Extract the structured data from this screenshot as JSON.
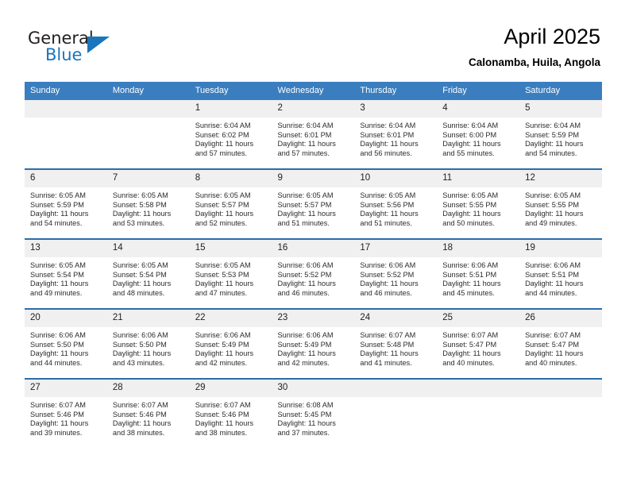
{
  "logo": {
    "word_one": "General",
    "word_two": "Blue",
    "triangle_color": "#1b75bb",
    "text_color": "#231f20"
  },
  "header": {
    "title": "April 2025",
    "location": "Calonamba, Huila, Angola"
  },
  "calendar": {
    "header_bg": "#3a7ebf",
    "row_divider_color": "#2c6ca8",
    "daynum_bg": "#f0f0f0",
    "weekdays": [
      "Sunday",
      "Monday",
      "Tuesday",
      "Wednesday",
      "Thursday",
      "Friday",
      "Saturday"
    ],
    "weeks": [
      [
        {
          "day": "",
          "lines": [
            "",
            "",
            "",
            ""
          ]
        },
        {
          "day": "",
          "lines": [
            "",
            "",
            "",
            ""
          ]
        },
        {
          "day": "1",
          "lines": [
            "Sunrise: 6:04 AM",
            "Sunset: 6:02 PM",
            "Daylight: 11 hours",
            "and 57 minutes."
          ]
        },
        {
          "day": "2",
          "lines": [
            "Sunrise: 6:04 AM",
            "Sunset: 6:01 PM",
            "Daylight: 11 hours",
            "and 57 minutes."
          ]
        },
        {
          "day": "3",
          "lines": [
            "Sunrise: 6:04 AM",
            "Sunset: 6:01 PM",
            "Daylight: 11 hours",
            "and 56 minutes."
          ]
        },
        {
          "day": "4",
          "lines": [
            "Sunrise: 6:04 AM",
            "Sunset: 6:00 PM",
            "Daylight: 11 hours",
            "and 55 minutes."
          ]
        },
        {
          "day": "5",
          "lines": [
            "Sunrise: 6:04 AM",
            "Sunset: 5:59 PM",
            "Daylight: 11 hours",
            "and 54 minutes."
          ]
        }
      ],
      [
        {
          "day": "6",
          "lines": [
            "Sunrise: 6:05 AM",
            "Sunset: 5:59 PM",
            "Daylight: 11 hours",
            "and 54 minutes."
          ]
        },
        {
          "day": "7",
          "lines": [
            "Sunrise: 6:05 AM",
            "Sunset: 5:58 PM",
            "Daylight: 11 hours",
            "and 53 minutes."
          ]
        },
        {
          "day": "8",
          "lines": [
            "Sunrise: 6:05 AM",
            "Sunset: 5:57 PM",
            "Daylight: 11 hours",
            "and 52 minutes."
          ]
        },
        {
          "day": "9",
          "lines": [
            "Sunrise: 6:05 AM",
            "Sunset: 5:57 PM",
            "Daylight: 11 hours",
            "and 51 minutes."
          ]
        },
        {
          "day": "10",
          "lines": [
            "Sunrise: 6:05 AM",
            "Sunset: 5:56 PM",
            "Daylight: 11 hours",
            "and 51 minutes."
          ]
        },
        {
          "day": "11",
          "lines": [
            "Sunrise: 6:05 AM",
            "Sunset: 5:55 PM",
            "Daylight: 11 hours",
            "and 50 minutes."
          ]
        },
        {
          "day": "12",
          "lines": [
            "Sunrise: 6:05 AM",
            "Sunset: 5:55 PM",
            "Daylight: 11 hours",
            "and 49 minutes."
          ]
        }
      ],
      [
        {
          "day": "13",
          "lines": [
            "Sunrise: 6:05 AM",
            "Sunset: 5:54 PM",
            "Daylight: 11 hours",
            "and 49 minutes."
          ]
        },
        {
          "day": "14",
          "lines": [
            "Sunrise: 6:05 AM",
            "Sunset: 5:54 PM",
            "Daylight: 11 hours",
            "and 48 minutes."
          ]
        },
        {
          "day": "15",
          "lines": [
            "Sunrise: 6:05 AM",
            "Sunset: 5:53 PM",
            "Daylight: 11 hours",
            "and 47 minutes."
          ]
        },
        {
          "day": "16",
          "lines": [
            "Sunrise: 6:06 AM",
            "Sunset: 5:52 PM",
            "Daylight: 11 hours",
            "and 46 minutes."
          ]
        },
        {
          "day": "17",
          "lines": [
            "Sunrise: 6:06 AM",
            "Sunset: 5:52 PM",
            "Daylight: 11 hours",
            "and 46 minutes."
          ]
        },
        {
          "day": "18",
          "lines": [
            "Sunrise: 6:06 AM",
            "Sunset: 5:51 PM",
            "Daylight: 11 hours",
            "and 45 minutes."
          ]
        },
        {
          "day": "19",
          "lines": [
            "Sunrise: 6:06 AM",
            "Sunset: 5:51 PM",
            "Daylight: 11 hours",
            "and 44 minutes."
          ]
        }
      ],
      [
        {
          "day": "20",
          "lines": [
            "Sunrise: 6:06 AM",
            "Sunset: 5:50 PM",
            "Daylight: 11 hours",
            "and 44 minutes."
          ]
        },
        {
          "day": "21",
          "lines": [
            "Sunrise: 6:06 AM",
            "Sunset: 5:50 PM",
            "Daylight: 11 hours",
            "and 43 minutes."
          ]
        },
        {
          "day": "22",
          "lines": [
            "Sunrise: 6:06 AM",
            "Sunset: 5:49 PM",
            "Daylight: 11 hours",
            "and 42 minutes."
          ]
        },
        {
          "day": "23",
          "lines": [
            "Sunrise: 6:06 AM",
            "Sunset: 5:49 PM",
            "Daylight: 11 hours",
            "and 42 minutes."
          ]
        },
        {
          "day": "24",
          "lines": [
            "Sunrise: 6:07 AM",
            "Sunset: 5:48 PM",
            "Daylight: 11 hours",
            "and 41 minutes."
          ]
        },
        {
          "day": "25",
          "lines": [
            "Sunrise: 6:07 AM",
            "Sunset: 5:47 PM",
            "Daylight: 11 hours",
            "and 40 minutes."
          ]
        },
        {
          "day": "26",
          "lines": [
            "Sunrise: 6:07 AM",
            "Sunset: 5:47 PM",
            "Daylight: 11 hours",
            "and 40 minutes."
          ]
        }
      ],
      [
        {
          "day": "27",
          "lines": [
            "Sunrise: 6:07 AM",
            "Sunset: 5:46 PM",
            "Daylight: 11 hours",
            "and 39 minutes."
          ]
        },
        {
          "day": "28",
          "lines": [
            "Sunrise: 6:07 AM",
            "Sunset: 5:46 PM",
            "Daylight: 11 hours",
            "and 38 minutes."
          ]
        },
        {
          "day": "29",
          "lines": [
            "Sunrise: 6:07 AM",
            "Sunset: 5:46 PM",
            "Daylight: 11 hours",
            "and 38 minutes."
          ]
        },
        {
          "day": "30",
          "lines": [
            "Sunrise: 6:08 AM",
            "Sunset: 5:45 PM",
            "Daylight: 11 hours",
            "and 37 minutes."
          ]
        },
        {
          "day": "",
          "lines": [
            "",
            "",
            "",
            ""
          ]
        },
        {
          "day": "",
          "lines": [
            "",
            "",
            "",
            ""
          ]
        },
        {
          "day": "",
          "lines": [
            "",
            "",
            "",
            ""
          ]
        }
      ]
    ]
  }
}
